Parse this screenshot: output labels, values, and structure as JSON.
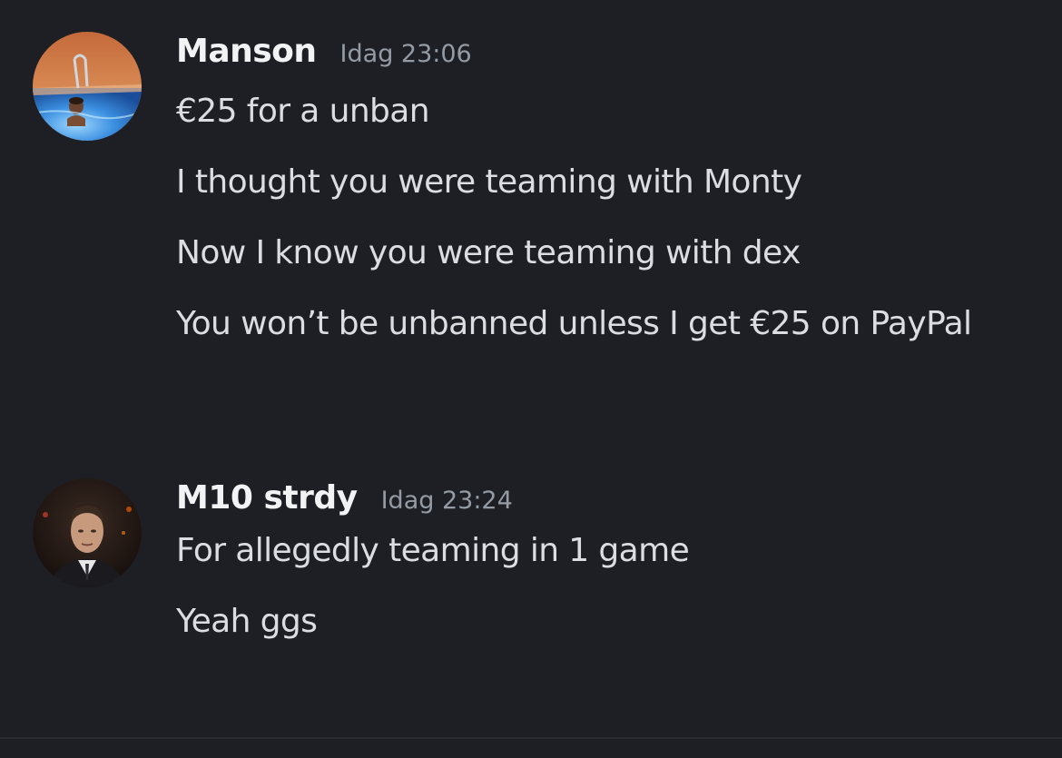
{
  "colors": {
    "background": "#1e1f24",
    "username": "#f2f3f5",
    "timestamp": "#949ba4",
    "message_text": "#dbdee1"
  },
  "messages": [
    {
      "author": "Manson",
      "timestamp": "Idag 23:06",
      "avatar": "pool-photo-avatar",
      "lines": [
        "€25 for a unban",
        "I thought you were teaming with Monty",
        "Now I know you were teaming with dex",
        "You won’t be unbanned unless I get €25 on PayPal"
      ]
    },
    {
      "author": "M10 strdy",
      "timestamp": "Idag 23:24",
      "avatar": "suited-man-photo-avatar",
      "lines": [
        "For allegedly teaming in 1 game",
        "Yeah ggs"
      ]
    }
  ]
}
